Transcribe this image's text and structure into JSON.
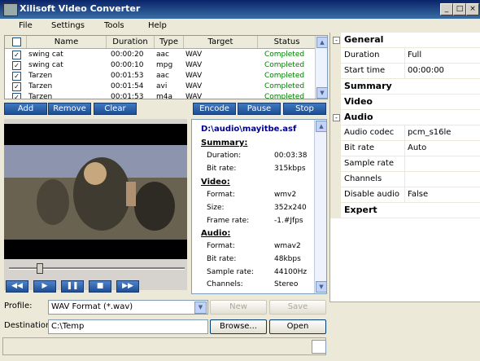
{
  "window": {
    "title": "Xilisoft Video Converter",
    "minimize": "_",
    "maximize": "□",
    "close": "×"
  },
  "menu": [
    "File",
    "Settings",
    "Tools",
    "Help"
  ],
  "filelist": {
    "columns": [
      "Name",
      "Duration",
      "Type",
      "Target",
      "Status"
    ],
    "rows": [
      {
        "checked": true,
        "name": "swing cat",
        "duration": "00:00:20",
        "type": "aac",
        "target": "WAV",
        "status": "Completed"
      },
      {
        "checked": true,
        "name": "swing cat",
        "duration": "00:00:10",
        "type": "mpg",
        "target": "WAV",
        "status": "Completed"
      },
      {
        "checked": true,
        "name": "Tarzen",
        "duration": "00:01:53",
        "type": "aac",
        "target": "WAV",
        "status": "Completed"
      },
      {
        "checked": true,
        "name": "Tarzen",
        "duration": "00:01:54",
        "type": "avi",
        "target": "WAV",
        "status": "Completed"
      },
      {
        "checked": true,
        "name": "Tarzen",
        "duration": "00:01:53",
        "type": "m4a",
        "target": "WAV",
        "status": "Completed"
      }
    ]
  },
  "actions": {
    "add": "Add",
    "remove": "Remove",
    "clear": "Clear",
    "encode": "Encode",
    "pause": "Pause",
    "stop": "Stop"
  },
  "player": {
    "progress": 0.17,
    "buttons": [
      "◀◀",
      "▶",
      "❚❚",
      "■",
      "▶▶"
    ]
  },
  "info": {
    "path": "D:\\audio\\mayitbe.asf",
    "summary_title": "Summary:",
    "summary": [
      {
        "k": "Duration:",
        "v": "00:03:38"
      },
      {
        "k": "Bit rate:",
        "v": "315kbps"
      }
    ],
    "video_title": "Video:",
    "video": [
      {
        "k": "Format:",
        "v": "wmv2"
      },
      {
        "k": "Size:",
        "v": "352x240"
      },
      {
        "k": "Frame rate:",
        "v": "-1.#Jfps"
      }
    ],
    "audio_title": "Audio:",
    "audio": [
      {
        "k": "Format:",
        "v": "wmav2"
      },
      {
        "k": "Bit rate:",
        "v": "48kbps"
      },
      {
        "k": "Sample rate:",
        "v": "44100Hz"
      },
      {
        "k": "Channels:",
        "v": "Stereo"
      }
    ]
  },
  "profile": {
    "label": "Profile:",
    "value": "WAV Format  (*.wav)",
    "new_label": "New",
    "save_label": "Save"
  },
  "destination": {
    "label": "Destination:",
    "value": "C:\\Temp",
    "browse_label": "Browse...",
    "open_label": "Open"
  },
  "properties": [
    {
      "kind": "category",
      "label": "General",
      "toggle": "-"
    },
    {
      "kind": "prop",
      "key": "Duration",
      "value": "Full"
    },
    {
      "kind": "prop",
      "key": "Start time",
      "value": "00:00:00"
    },
    {
      "kind": "category",
      "label": "Summary"
    },
    {
      "kind": "category",
      "label": "Video"
    },
    {
      "kind": "category",
      "label": "Audio",
      "toggle": "-"
    },
    {
      "kind": "prop",
      "key": "Audio codec",
      "value": "pcm_s16le"
    },
    {
      "kind": "prop",
      "key": "Bit rate",
      "value": "Auto"
    },
    {
      "kind": "prop",
      "key": "Sample rate",
      "value": ""
    },
    {
      "kind": "prop",
      "key": "Channels",
      "value": ""
    },
    {
      "kind": "prop",
      "key": "Disable audio",
      "value": "False"
    },
    {
      "kind": "category",
      "label": "Expert"
    }
  ],
  "icons": {
    "checkbox": "checkbox-icon",
    "dropdown": "chevron-down-icon",
    "scroll_up": "scroll-up-icon",
    "scroll_down": "scroll-down-icon"
  }
}
